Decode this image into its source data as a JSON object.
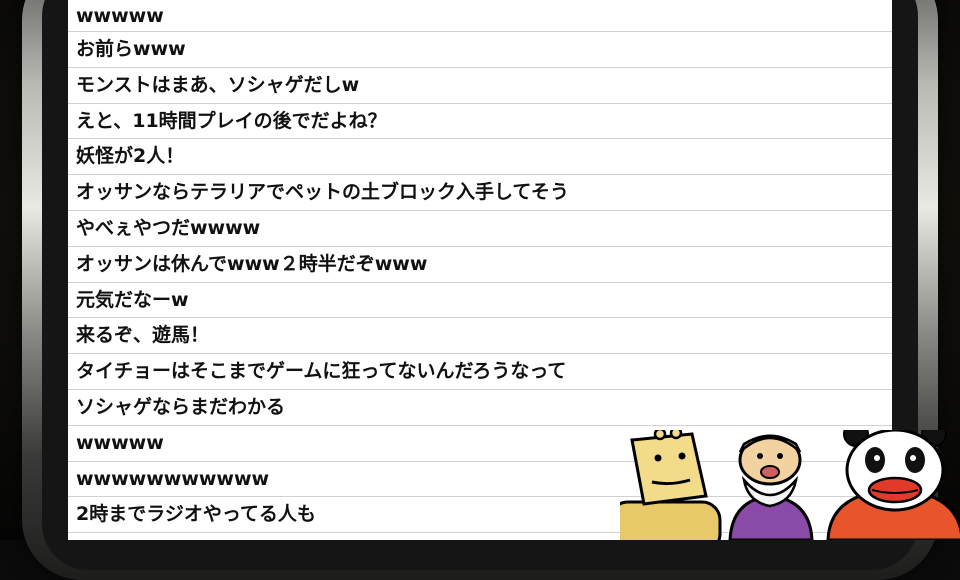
{
  "comments": [
    "wwwww",
    "お前らwww",
    "モンストはまあ、ソシャゲだしw",
    "えと、11時間プレイの後でだよね？",
    "妖怪が2人！",
    "オッサンならテラリアでペットの土ブロック入手してそう",
    "やべぇやつだwwww",
    "オッサンは休んでwww２時半だぞwww",
    "元気だなーw",
    "来るぞ、遊馬！",
    "タイチョーはそこまでゲームに狂ってないんだろうなって",
    "ソシャゲならまだわかる",
    "wwwww",
    "wwwwwwwwwww",
    "2時までラジオやってる人も"
  ],
  "colors": {
    "screen_bg": "#ffffff",
    "text": "#111111",
    "divider": "#d2d2d2",
    "frame_silver": "#e9e9e4",
    "background": "#0b0b0b"
  },
  "characters": [
    {
      "name": "square-head-character-icon",
      "color": "#f2dc8a"
    },
    {
      "name": "grandpa-character-icon",
      "color": "#8a4aa8"
    },
    {
      "name": "panda-character-icon",
      "color": "#e8552a"
    }
  ]
}
